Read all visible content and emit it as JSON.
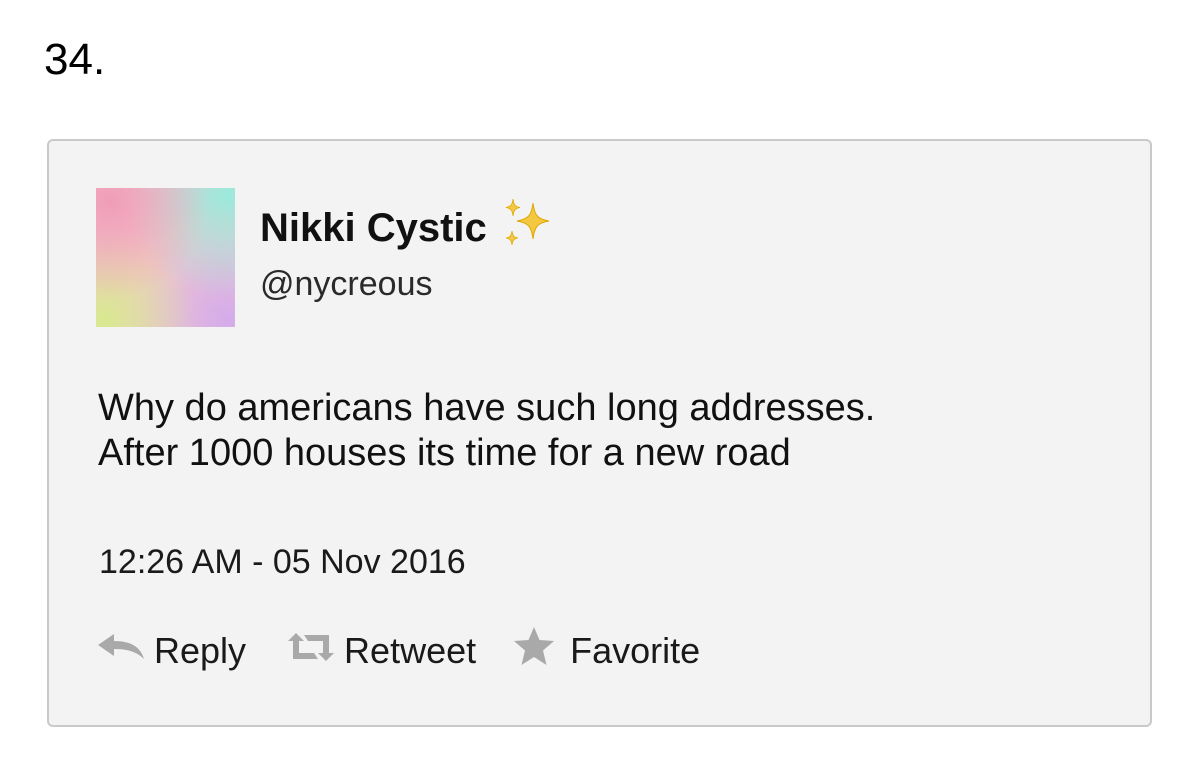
{
  "list_number": "34.",
  "tweet": {
    "display_name": "Nikki Cystic",
    "name_emoji": "sparkles-icon",
    "handle": "@nycreous",
    "text_lines": [
      "Why do americans have such long addresses.",
      "After 1000 houses its time for a new road"
    ],
    "timestamp": "12:26 AM - 05 Nov 2016"
  },
  "actions": {
    "reply": {
      "label": "Reply",
      "icon": "reply-icon"
    },
    "retweet": {
      "label": "Retweet",
      "icon": "retweet-icon"
    },
    "favorite": {
      "label": "Favorite",
      "icon": "star-icon"
    }
  },
  "colors": {
    "card_background": "#f3f3f3",
    "card_border": "#c9c9c9",
    "icon_gray": "#a9a9a9",
    "sparkle_gold": "#f5c842"
  }
}
